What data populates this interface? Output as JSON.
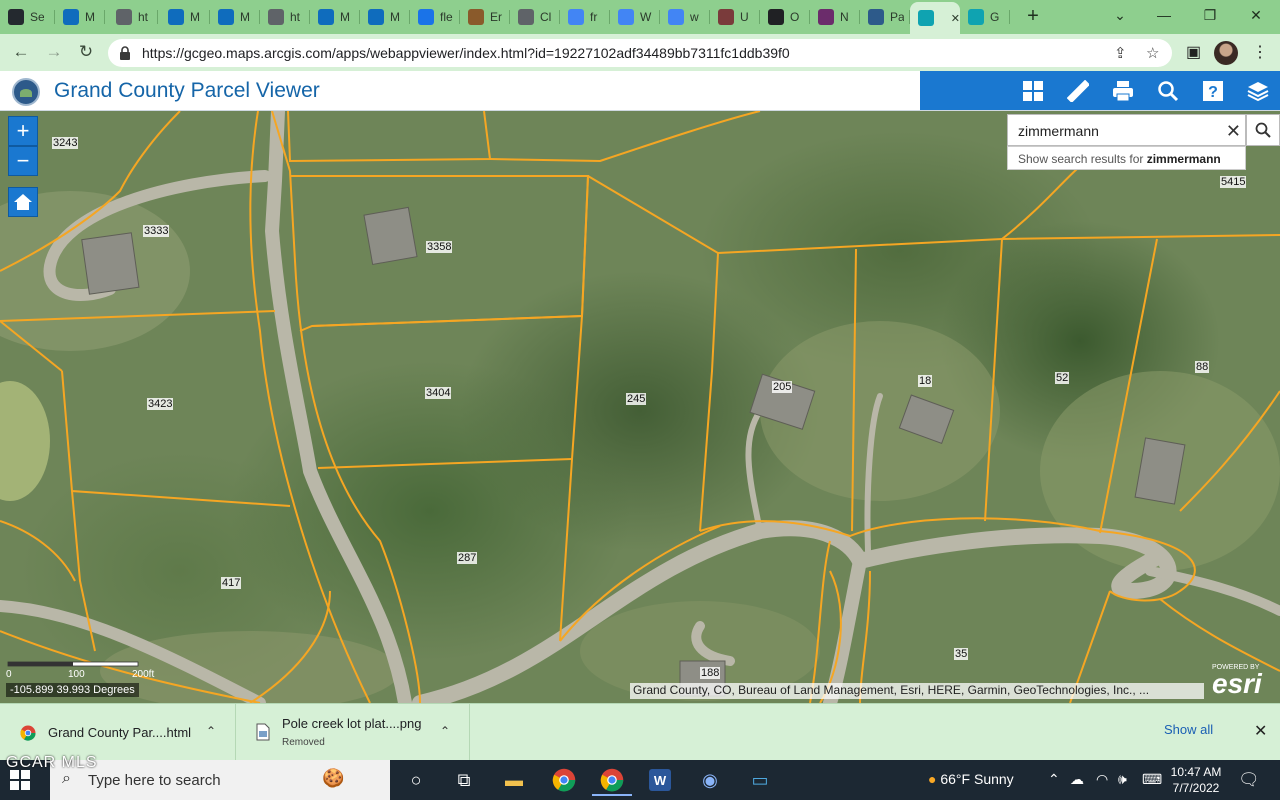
{
  "browser": {
    "tabs": [
      {
        "label": "Se",
        "icon": "github-icon",
        "color": "#24292f"
      },
      {
        "label": "M",
        "icon": "outlook-icon",
        "color": "#0f6cbd"
      },
      {
        "label": "ht",
        "icon": "document-icon",
        "color": "#5f6368"
      },
      {
        "label": "M",
        "icon": "outlook-icon",
        "color": "#0f6cbd"
      },
      {
        "label": "M",
        "icon": "outlook-icon",
        "color": "#0f6cbd"
      },
      {
        "label": "ht",
        "icon": "document-icon",
        "color": "#5f6368"
      },
      {
        "label": "M",
        "icon": "outlook-icon",
        "color": "#0f6cbd"
      },
      {
        "label": "M",
        "icon": "outlook-icon",
        "color": "#0f6cbd"
      },
      {
        "label": "fle",
        "icon": "globe-icon",
        "color": "#1a73e8"
      },
      {
        "label": "Er",
        "icon": "image-icon",
        "color": "#8a5a2b"
      },
      {
        "label": "Cl",
        "icon": "document-icon",
        "color": "#5f6368"
      },
      {
        "label": "fr",
        "icon": "google-icon",
        "color": "#4285f4"
      },
      {
        "label": "W",
        "icon": "google-icon",
        "color": "#4285f4"
      },
      {
        "label": "w",
        "icon": "google-icon",
        "color": "#4285f4"
      },
      {
        "label": "U",
        "icon": "uc-icon",
        "color": "#7a3b3b"
      },
      {
        "label": "O",
        "icon": "globe-icon",
        "color": "#202124"
      },
      {
        "label": "N",
        "icon": "link-icon",
        "color": "#6b2c6b"
      },
      {
        "label": "Pa",
        "icon": "parcel-icon",
        "color": "#2d5a8a"
      },
      {
        "label": "",
        "icon": "bing-icon",
        "color": "#0fa3b1",
        "active": true
      },
      {
        "label": "G",
        "icon": "bing-icon",
        "color": "#0fa3b1"
      }
    ],
    "url": "https://gcgeo.maps.arcgis.com/apps/webappviewer/index.html?id=19227102adf34489bb7311fc1ddb39f0"
  },
  "app": {
    "title": "Grand County Parcel Viewer",
    "tools": [
      "grid-icon",
      "measure-icon",
      "print-icon",
      "search-icon",
      "help-icon",
      "layers-icon"
    ]
  },
  "map": {
    "search_value": "zimmermann",
    "suggest_prefix": "Show search results for ",
    "suggest_term": "zimmermann",
    "parcels": [
      {
        "label": "3243"
      },
      {
        "label": "3333"
      },
      {
        "label": "3358"
      },
      {
        "label": "3423"
      },
      {
        "label": "3404"
      },
      {
        "label": "245"
      },
      {
        "label": "205"
      },
      {
        "label": "18"
      },
      {
        "label": "52"
      },
      {
        "label": "88"
      },
      {
        "label": "5415"
      },
      {
        "label": "287"
      },
      {
        "label": "417"
      },
      {
        "label": "188"
      },
      {
        "label": "35"
      }
    ],
    "scale": {
      "t0": "0",
      "t1": "100",
      "t2": "200ft"
    },
    "coords": "-105.899 39.993 Degrees",
    "attribution": "Grand County, CO, Bureau of Land Management, Esri, HERE, Garmin, GeoTechnologies, Inc., ...",
    "esri_powered": "POWERED BY",
    "esri_logo": "esri",
    "parcel_line_color": "#f5a623"
  },
  "downloads": {
    "items": [
      {
        "name": "Grand County Par....html",
        "status": ""
      },
      {
        "name": "Pole creek lot plat....png",
        "status": "Removed"
      }
    ],
    "show_all": "Show all"
  },
  "overlay_text": "GCAR MLS",
  "taskbar": {
    "search_placeholder": "Type here to search",
    "weather_temp": "66°F",
    "weather_desc": "Sunny",
    "time": "10:47 AM",
    "date": "7/7/2022"
  }
}
